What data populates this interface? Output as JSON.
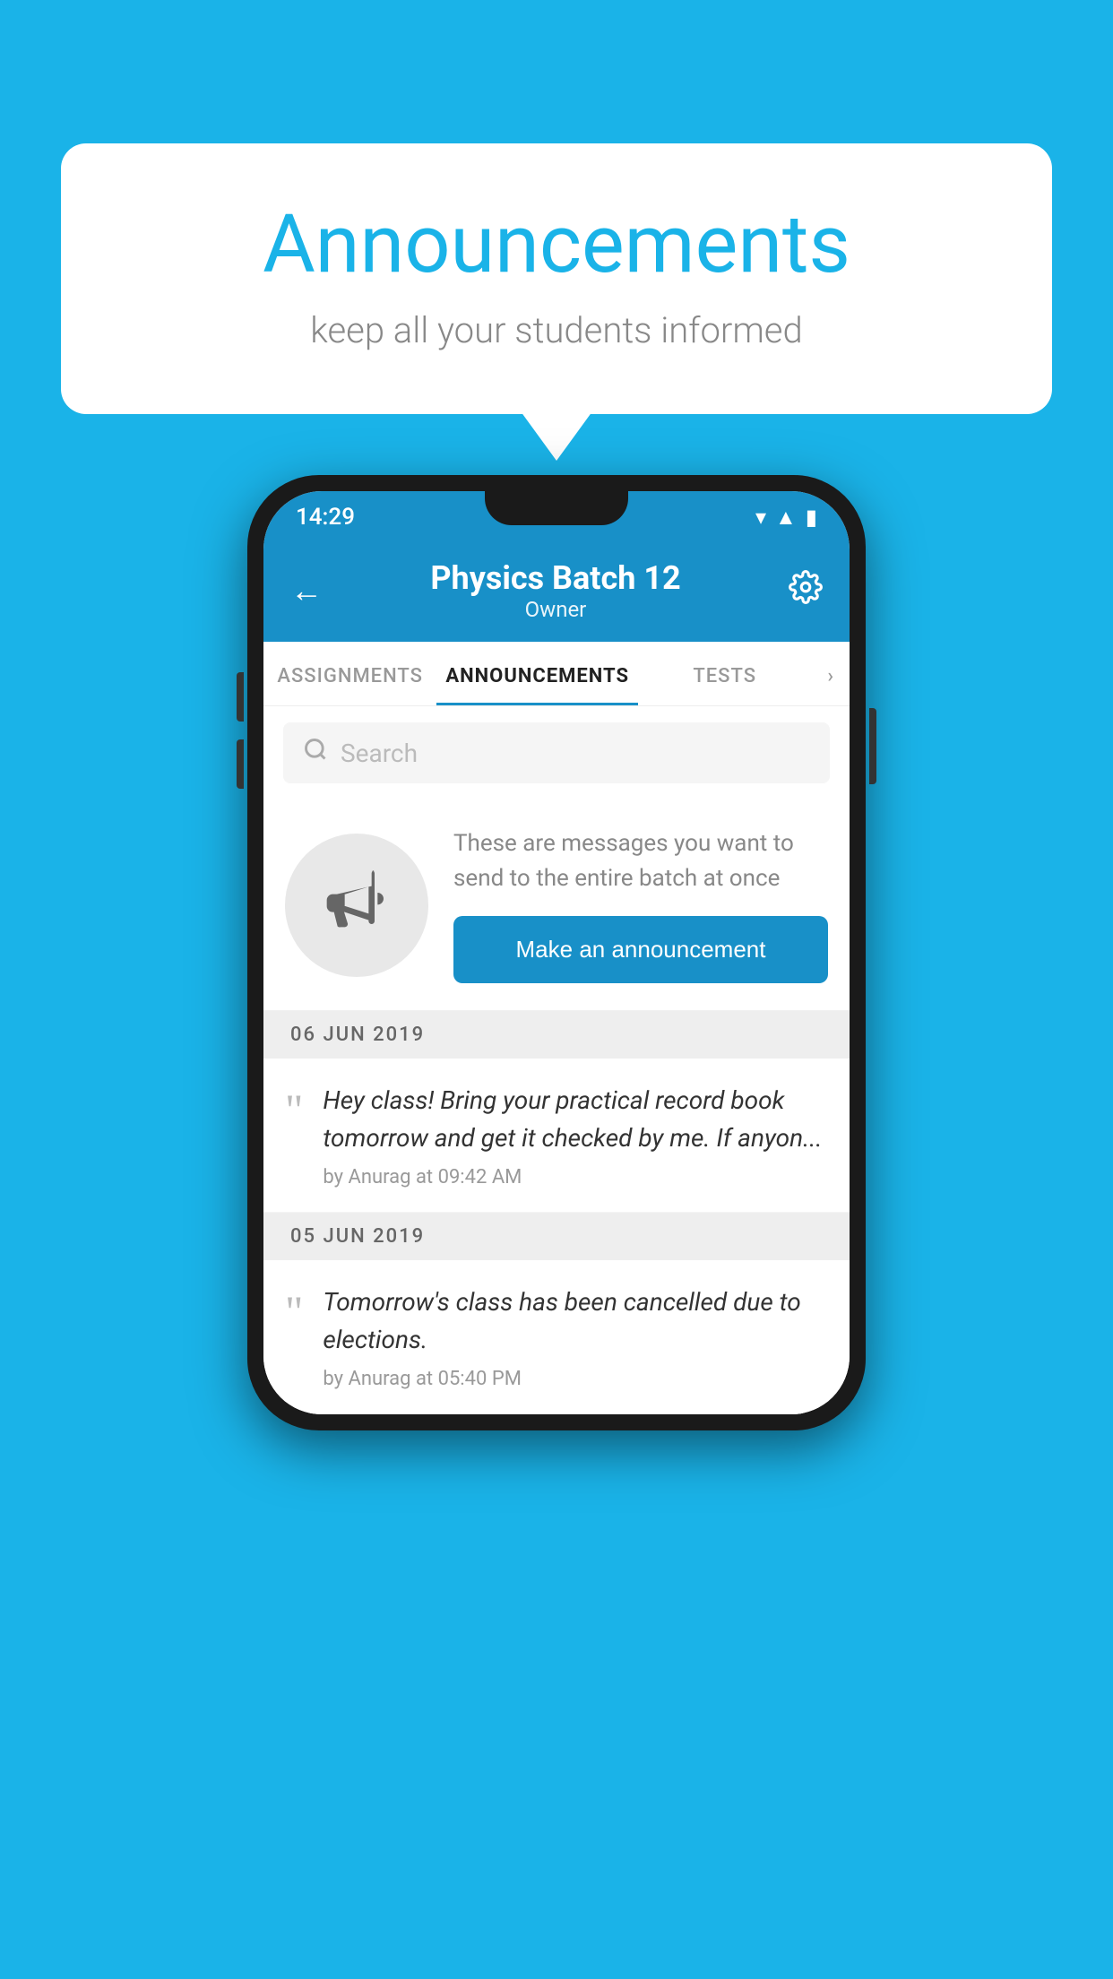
{
  "background_color": "#1ab3e8",
  "bubble": {
    "title": "Announcements",
    "subtitle": "keep all your students informed"
  },
  "phone": {
    "status_bar": {
      "time": "14:29"
    },
    "header": {
      "title": "Physics Batch 12",
      "subtitle": "Owner"
    },
    "tabs": [
      {
        "label": "ASSIGNMENTS",
        "active": false
      },
      {
        "label": "ANNOUNCEMENTS",
        "active": true
      },
      {
        "label": "TESTS",
        "active": false
      },
      {
        "label": "›",
        "active": false
      }
    ],
    "search": {
      "placeholder": "Search"
    },
    "promo": {
      "description_text": "These are messages you want to send to the entire batch at once",
      "cta_label": "Make an announcement"
    },
    "announcements": [
      {
        "date": "06  JUN  2019",
        "text": "Hey class! Bring your practical record book tomorrow and get it checked by me. If anyon...",
        "meta": "by Anurag at 09:42 AM"
      },
      {
        "date": "05  JUN  2019",
        "text": "Tomorrow's class has been cancelled due to elections.",
        "meta": "by Anurag at 05:40 PM"
      }
    ]
  }
}
